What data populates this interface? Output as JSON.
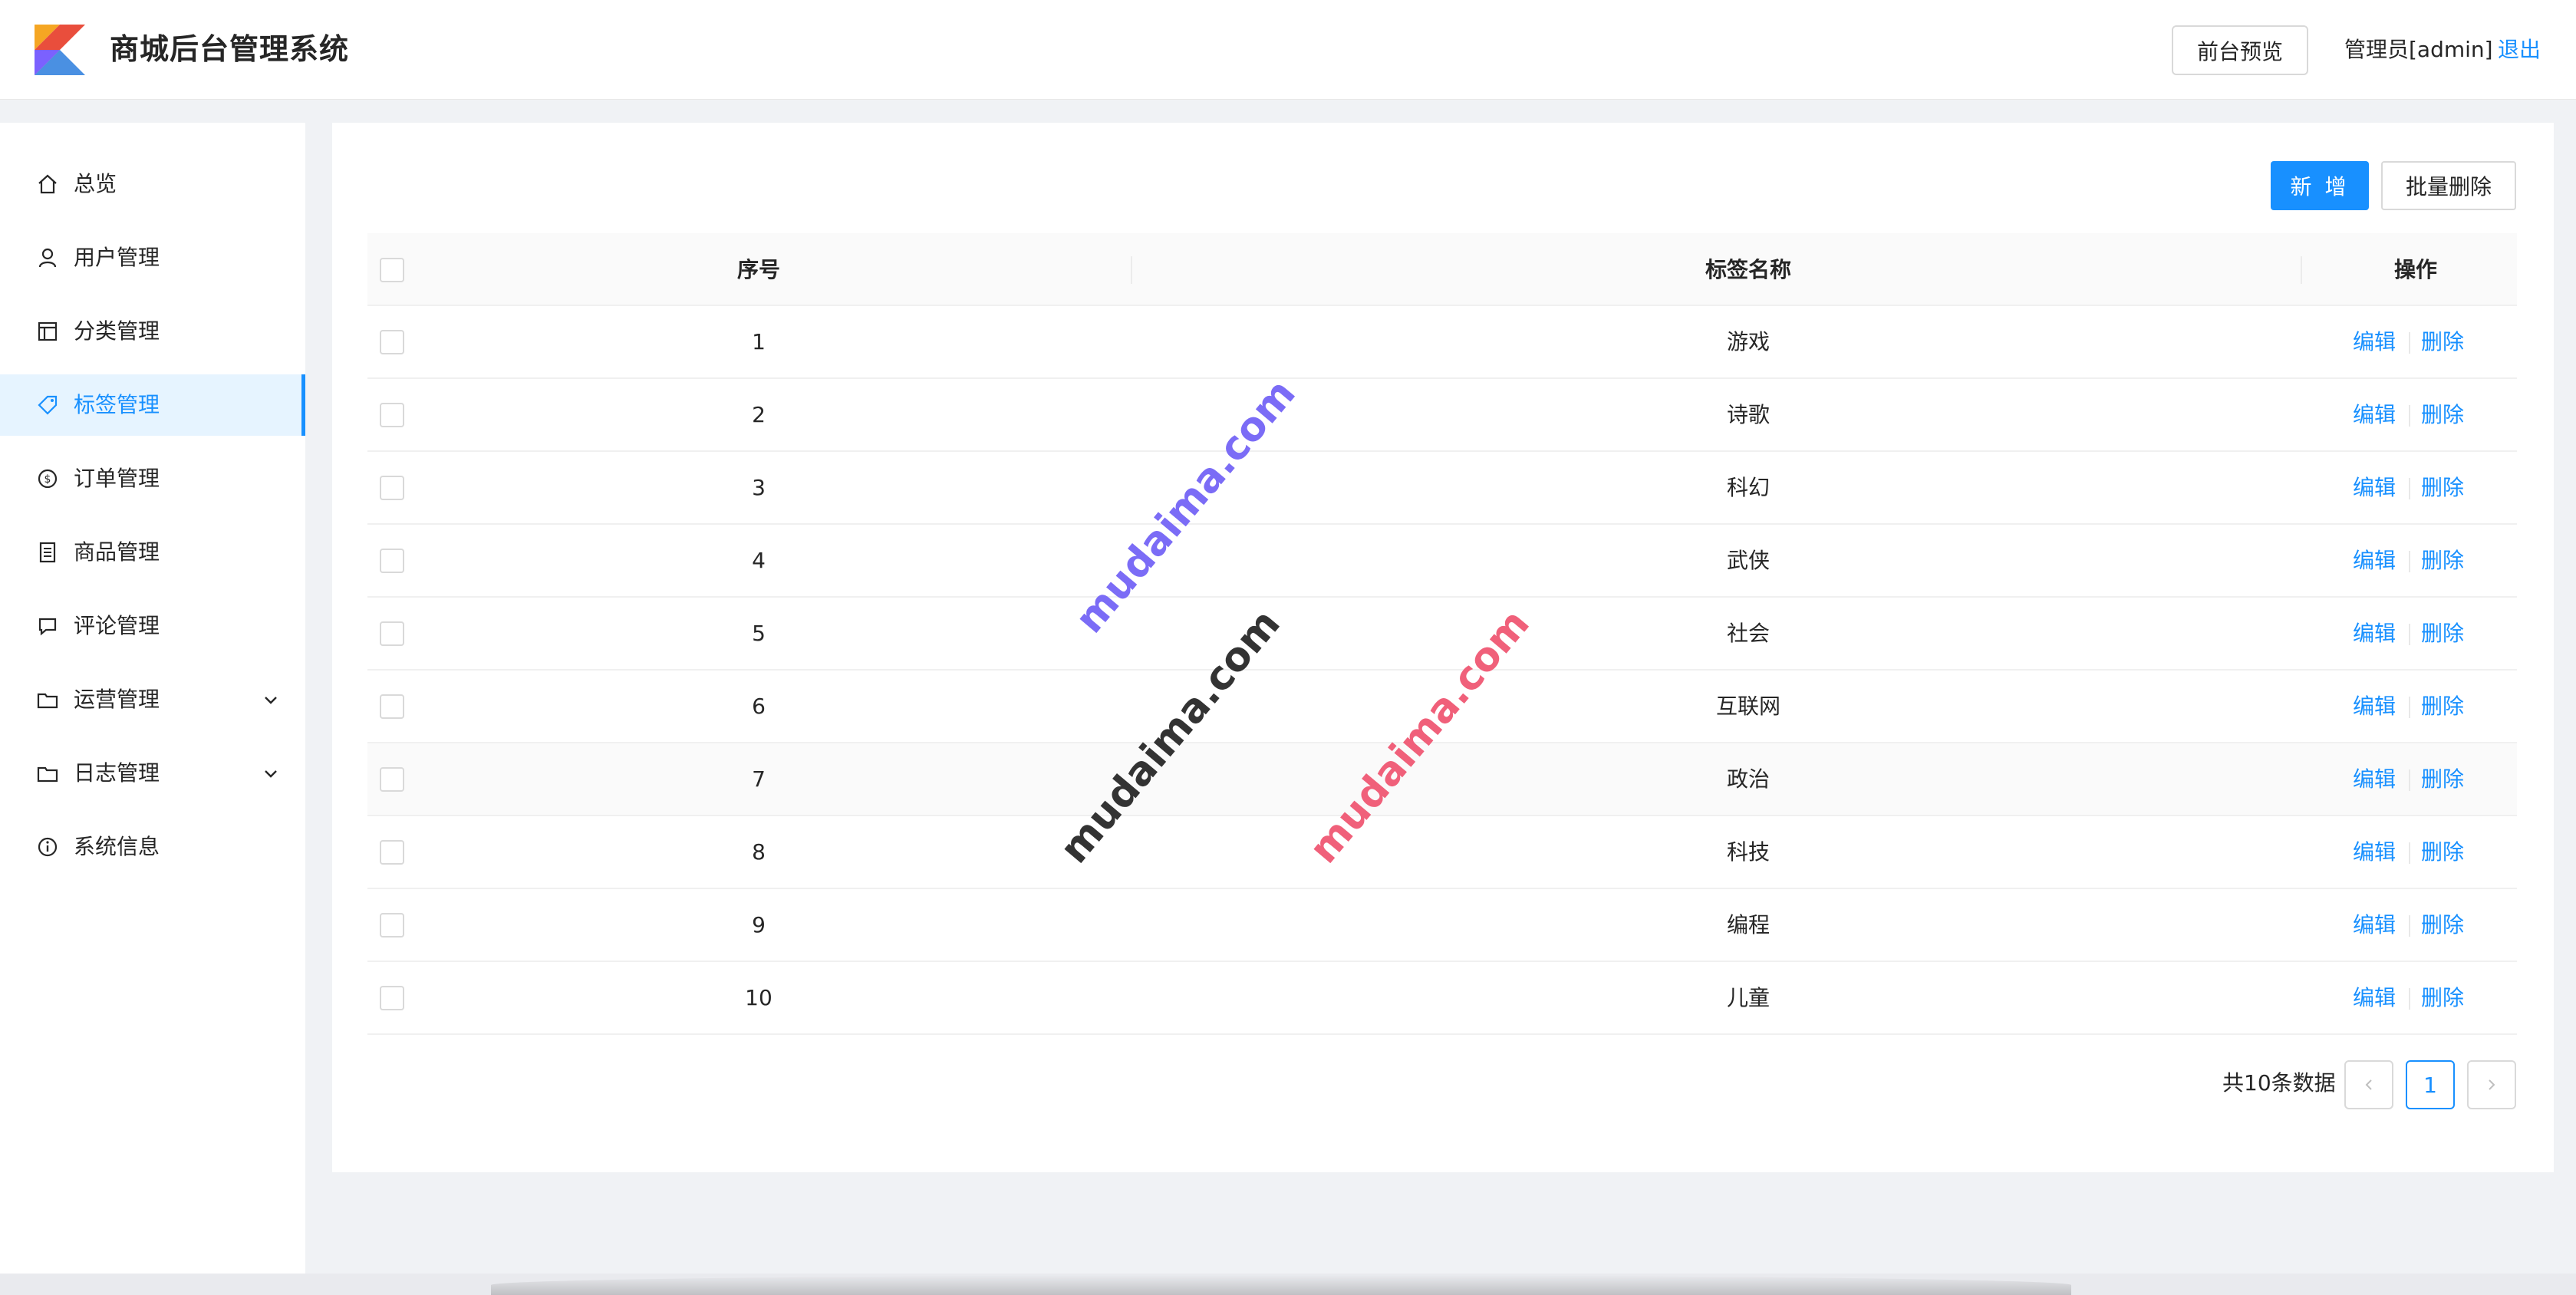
{
  "header": {
    "app_title": "商城后台管理系统",
    "preview_label": "前台预览",
    "admin_label": "管理员[admin]",
    "logout_label": "退出",
    "logo_colors": [
      "#f5a623",
      "#4a90e2",
      "#e94e3c",
      "#7b61ff"
    ]
  },
  "sidebar": {
    "items": [
      {
        "label": "总览",
        "icon": "home-icon"
      },
      {
        "label": "用户管理",
        "icon": "user-icon"
      },
      {
        "label": "分类管理",
        "icon": "layout-icon"
      },
      {
        "label": "标签管理",
        "icon": "tag-icon",
        "active": true
      },
      {
        "label": "订单管理",
        "icon": "dollar-icon"
      },
      {
        "label": "商品管理",
        "icon": "book-icon"
      },
      {
        "label": "评论管理",
        "icon": "comment-icon"
      },
      {
        "label": "运营管理",
        "icon": "folder-icon",
        "expandable": true
      },
      {
        "label": "日志管理",
        "icon": "folder-icon",
        "expandable": true
      },
      {
        "label": "系统信息",
        "icon": "info-icon"
      }
    ]
  },
  "toolbar": {
    "add_label": "新 增",
    "batch_delete_label": "批量删除"
  },
  "table": {
    "columns": [
      "序号",
      "标签名称",
      "操作"
    ],
    "edit_label": "编辑",
    "delete_label": "删除",
    "rows": [
      {
        "index": "1",
        "name": "游戏"
      },
      {
        "index": "2",
        "name": "诗歌"
      },
      {
        "index": "3",
        "name": "科幻"
      },
      {
        "index": "4",
        "name": "武侠"
      },
      {
        "index": "5",
        "name": "社会"
      },
      {
        "index": "6",
        "name": "互联网"
      },
      {
        "index": "7",
        "name": "政治"
      },
      {
        "index": "8",
        "name": "科技"
      },
      {
        "index": "9",
        "name": "编程"
      },
      {
        "index": "10",
        "name": "儿童"
      }
    ]
  },
  "pagination": {
    "total_text": "共10条数据",
    "current_page": "1"
  },
  "watermarks": [
    {
      "text": "mudaima.com",
      "color": "#7b6cf6"
    },
    {
      "text": "mudaima.com",
      "color": "#333333"
    },
    {
      "text": "mudaima.com",
      "color": "#f0607a"
    }
  ],
  "colors": {
    "accent": "#1890ff",
    "active_bg": "#e6f4ff"
  }
}
